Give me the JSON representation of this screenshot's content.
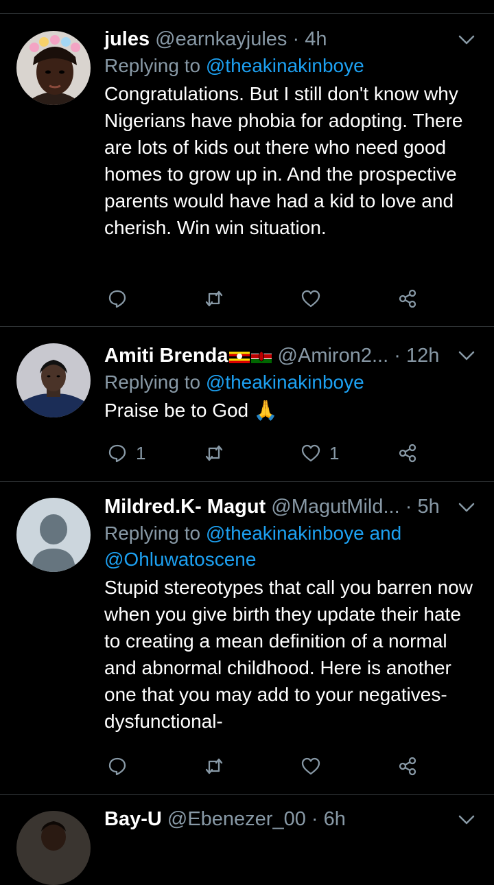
{
  "tweets": [
    {
      "name": "jules",
      "handle": "@earnkayjules",
      "sep": " · ",
      "time": "4h",
      "replying_prefix": "Replying to ",
      "replying_to": "@theakinakinboye",
      "replying_and": "",
      "replying_to_2": "",
      "text": "Congratulations. But I still don't know why Nigerians have phobia for adopting. There are lots of kids out there who need good homes to grow up in. And the prospective parents would have had a kid to love and cherish. Win win situation.",
      "reply_count": "",
      "retweet_count": "",
      "like_count": ""
    },
    {
      "name": "Amiti Brenda",
      "handle": "@Amiron2...",
      "sep": " · ",
      "time": "12h",
      "replying_prefix": "Replying to ",
      "replying_to": "@theakinakinboye",
      "replying_and": "",
      "replying_to_2": "",
      "text": "Praise be to God",
      "emoji": "🙏",
      "reply_count": "1",
      "retweet_count": "",
      "like_count": "1"
    },
    {
      "name": "Mildred.K- Magut",
      "handle": "@MagutMild...",
      "sep": " · ",
      "time": "5h",
      "replying_prefix": "Replying to ",
      "replying_to": "@theakinakinboye",
      "replying_and": " and",
      "replying_to_2": "@Ohluwatoscene",
      "text": "Stupid stereotypes that call you barren now when you give birth they update their hate to creating a mean definition of a normal and abnormal childhood. Here is another one that you may add to your negatives-dysfunctional-",
      "reply_count": "",
      "retweet_count": "",
      "like_count": ""
    },
    {
      "name": "Bay-U",
      "handle": "@Ebenezer_00",
      "sep": " · ",
      "time": "6h"
    }
  ],
  "icons": {
    "reply": "reply-icon",
    "retweet": "retweet-icon",
    "like": "heart-icon",
    "share": "share-icon",
    "more": "chevron-down-icon"
  },
  "colors": {
    "background": "#000000",
    "secondary_text": "#8899a6",
    "link": "#1da1f2",
    "divider": "#2f3336"
  }
}
